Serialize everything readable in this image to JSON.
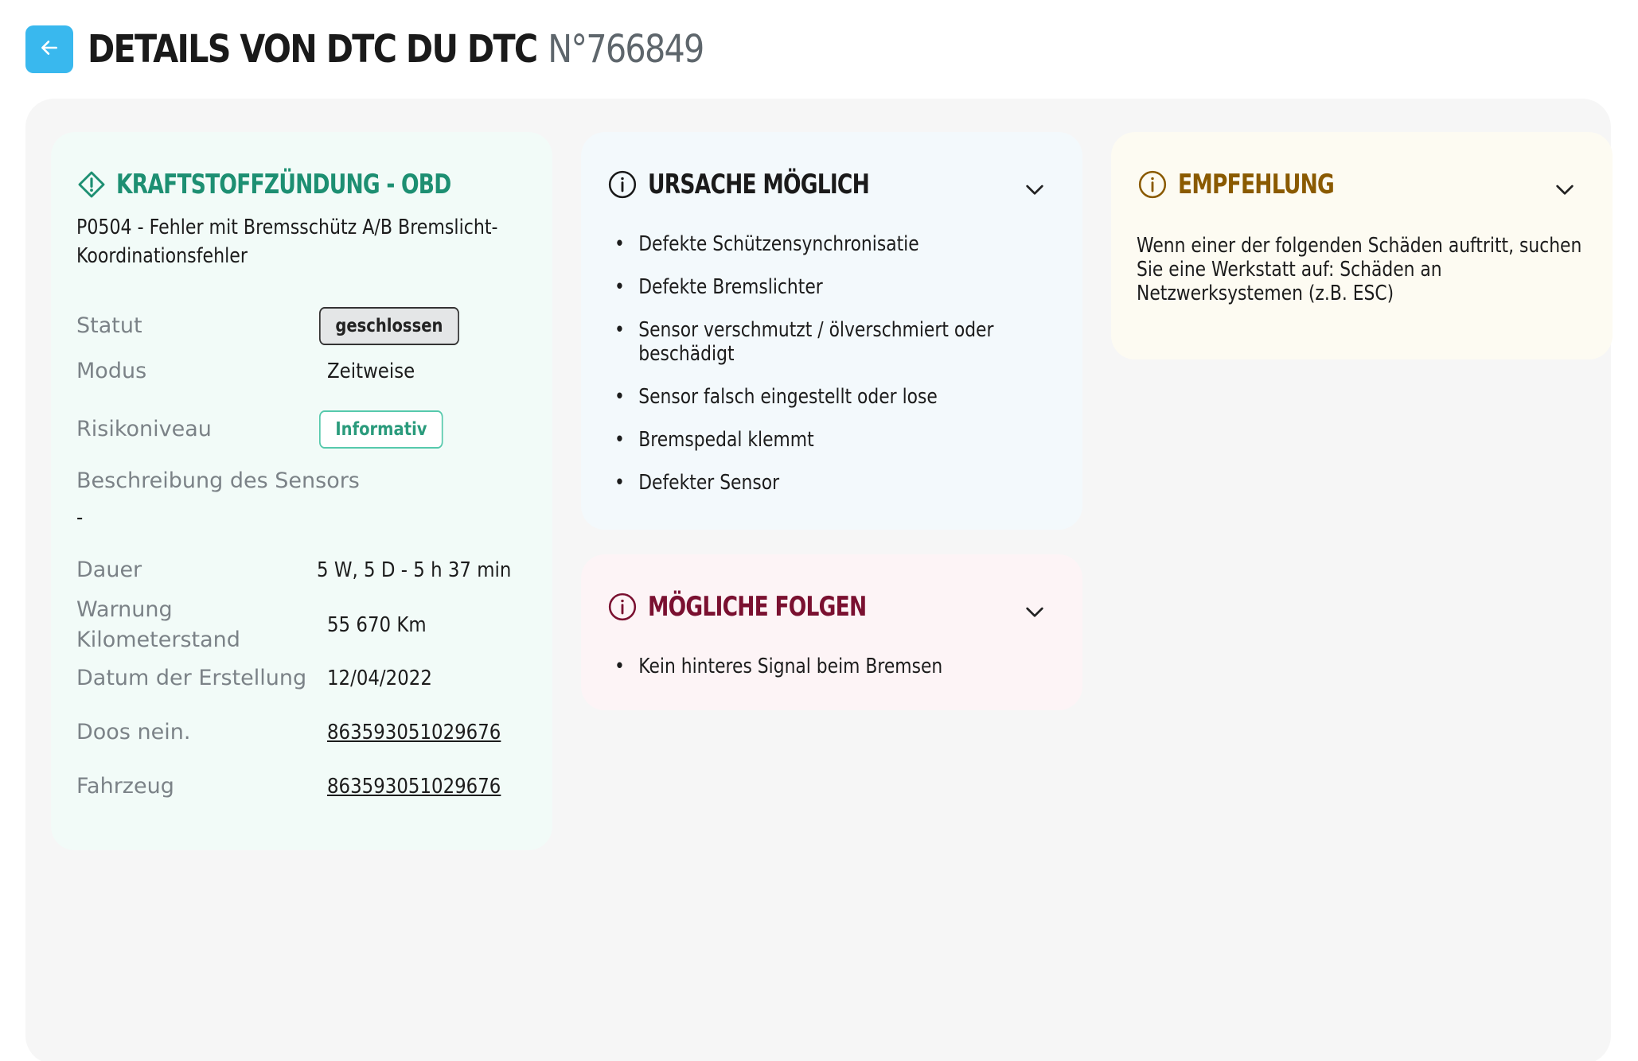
{
  "header": {
    "title": "Details von DTC du DTC",
    "dtc_number": "N°766849"
  },
  "dtc_card": {
    "title": "Kraftstoffzündung - OBD",
    "code_description": "P0504 - Fehler mit Bremsschütz A/B Bremslicht-Koordinationsfehler",
    "rows": {
      "status_label": "Statut",
      "status_value": "geschlossen",
      "mode_label": "Modus",
      "mode_value": "Zeitweise",
      "risk_label": "Risikoniveau",
      "risk_value": "Informativ",
      "sensor_desc_label": "Beschreibung des Sensors",
      "sensor_desc_value": "-",
      "duration_label": "Dauer",
      "duration_value": "5 W, 5 D - 5 h 37 min",
      "mileage_label": "Warnung Kilometerstand",
      "mileage_value": "55 670 Km",
      "created_label": "Datum der Erstellung",
      "created_value": "12/04/2022",
      "doos_label": "Doos nein.",
      "doos_value": "863593051029676",
      "vehicle_label": "Fahrzeug",
      "vehicle_value": "863593051029676"
    }
  },
  "cause_card": {
    "title": "Ursache möglich",
    "items": [
      "Defekte Schützensynchronisatie",
      "Defekte Bremslichter",
      "Sensor verschmutzt / ölverschmiert oder beschädigt",
      "Sensor falsch eingestellt oder lose",
      "Bremspedal klemmt",
      "Defekter Sensor"
    ]
  },
  "consequence_card": {
    "title": "Mögliche Folgen",
    "items": [
      "Kein hinteres Signal beim Bremsen"
    ]
  },
  "recommendation_card": {
    "title": "Empfehlung",
    "text": "Wenn einer der folgenden Schäden auftritt, suchen Sie eine Werkstatt auf: Schäden an Netzwerksystemen (z.B. ESC)"
  },
  "icons": {
    "back": "arrow-left-icon",
    "dtc": "warning-diamond-icon",
    "info": "info-circle-icon",
    "toggle": "chevron-down-icon"
  },
  "colors": {
    "accent_blue": "#39b8ee",
    "dtc_green": "#1d8f72",
    "cause_dark": "#1a1a1a",
    "consequence_red": "#7a1030",
    "recommendation_brown": "#8a5a00",
    "link": "#5a4fd1"
  }
}
